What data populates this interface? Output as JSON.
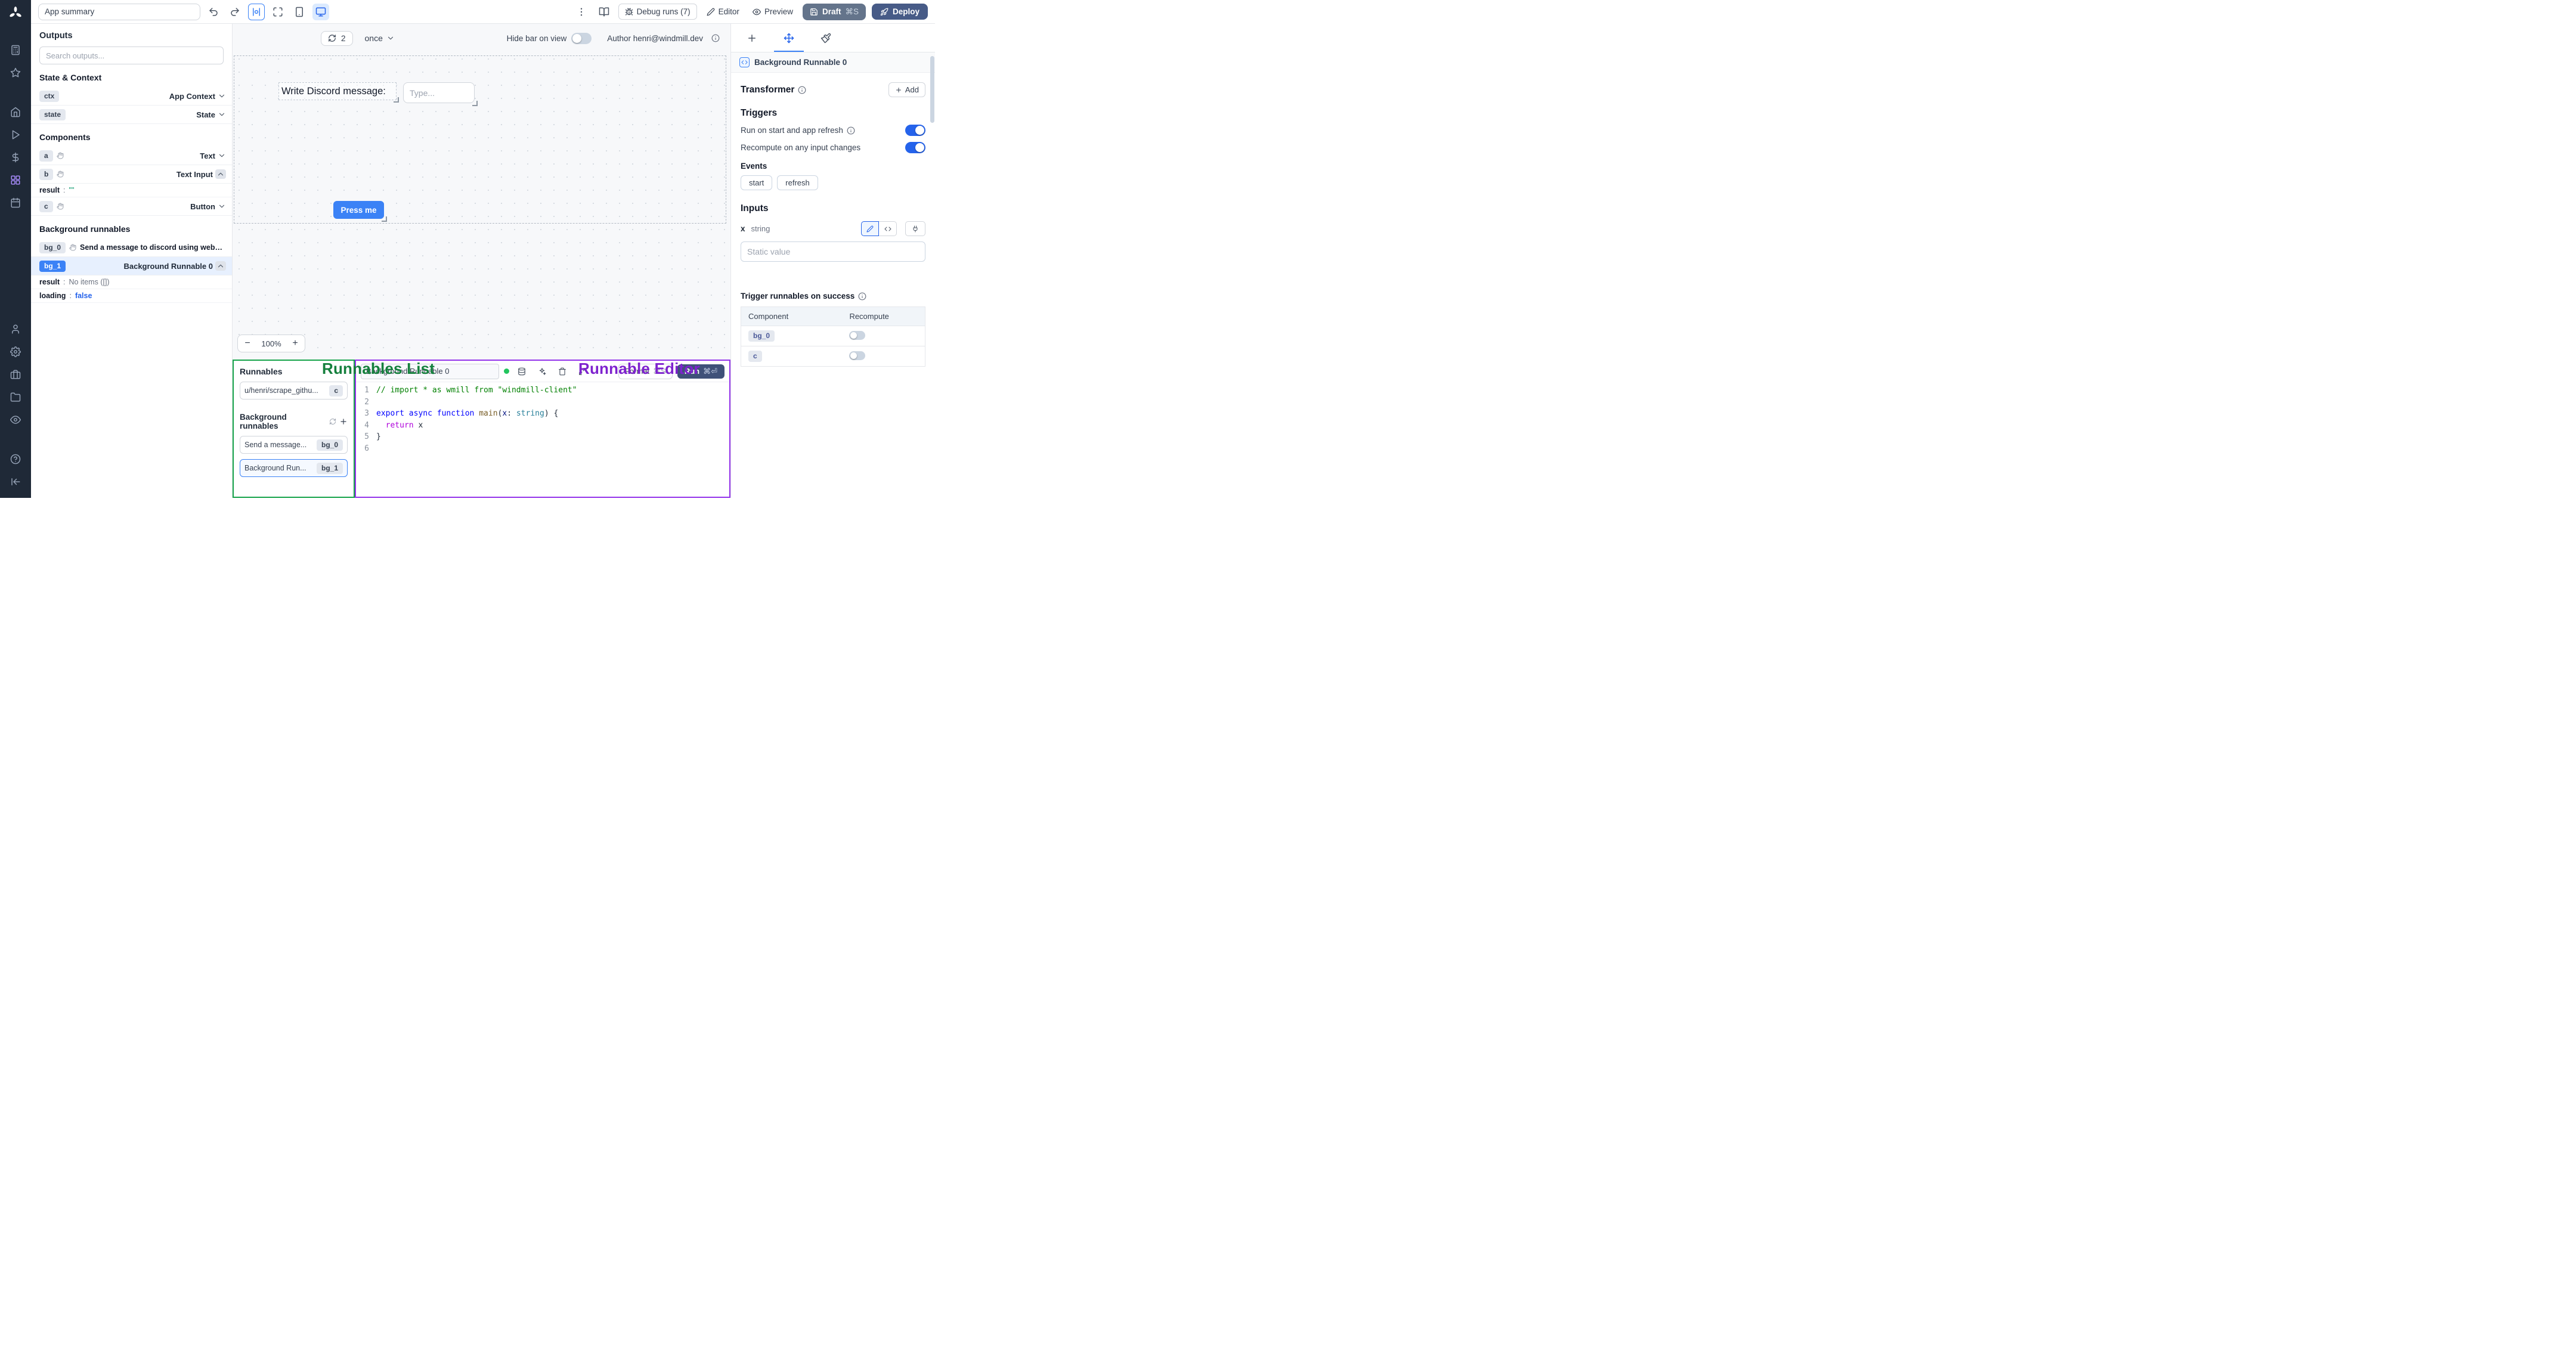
{
  "app": {
    "summary_value": "App summary"
  },
  "topbar": {
    "debug_runs_label": "Debug runs (7)",
    "editor_label": "Editor",
    "preview_label": "Preview",
    "draft_label": "Draft",
    "draft_shortcut": "⌘S",
    "deploy_label": "Deploy"
  },
  "outputs": {
    "title": "Outputs",
    "search_placeholder": "Search outputs...",
    "sections": {
      "state_context_title": "State & Context",
      "components_title": "Components",
      "background_title": "Background runnables"
    },
    "rows": {
      "ctx": {
        "badge": "ctx",
        "label": "App Context"
      },
      "state": {
        "badge": "state",
        "label": "State"
      },
      "a": {
        "badge": "a",
        "label": "Text"
      },
      "b": {
        "badge": "b",
        "label": "Text Input"
      },
      "c": {
        "badge": "c",
        "label": "Button"
      },
      "bg0": {
        "badge": "bg_0",
        "label": "Send a message to discord using webhoo"
      },
      "bg1": {
        "badge": "bg_1",
        "label": "Background Runnable 0"
      }
    },
    "details": {
      "colon": ":",
      "b_result_key": "result",
      "b_result_value": "\"\"",
      "bg1_result_key": "result",
      "bg1_result_value": "No items ([])",
      "bg1_loading_key": "loading",
      "bg1_loading_value": "false"
    }
  },
  "canvas": {
    "refresh_count": "2",
    "interval_value": "once",
    "hide_bar_label": "Hide bar on view",
    "author_label": "Author henri@windmill.dev",
    "zoom_minus": "−",
    "zoom_value": "100%",
    "zoom_plus": "+",
    "components": {
      "text_label": "Write Discord message:",
      "input_placeholder": "Type...",
      "button_label": "Press me"
    }
  },
  "annotations": {
    "runnables_list": "Runnables List",
    "runnable_editor": "Runnable Editor"
  },
  "runnables": {
    "title": "Runnables",
    "script_item": {
      "label": "u/henri/scrape_githu...",
      "badge": "c"
    },
    "background_title": "Background runnables",
    "bg_items": [
      {
        "label": "Send a message...",
        "badge": "bg_0"
      },
      {
        "label": "Background Run...",
        "badge": "bg_1"
      }
    ]
  },
  "editor": {
    "name_value": "Background Runnable 0",
    "format_label": "Format",
    "format_shortcut": "⌘S",
    "run_label": "Run",
    "run_shortcut": "⌘⏎",
    "code_lines": [
      {
        "n": "1",
        "tokens": [
          {
            "c": "comment",
            "t": "// import * as wmill from \"windmill-client\""
          }
        ]
      },
      {
        "n": "2",
        "tokens": []
      },
      {
        "n": "3",
        "tokens": [
          {
            "c": "kw",
            "t": "export"
          },
          {
            "c": "plain",
            "t": " "
          },
          {
            "c": "kw",
            "t": "async"
          },
          {
            "c": "plain",
            "t": " "
          },
          {
            "c": "kw",
            "t": "function"
          },
          {
            "c": "plain",
            "t": " "
          },
          {
            "c": "fn",
            "t": "main"
          },
          {
            "c": "plain",
            "t": "("
          },
          {
            "c": "var",
            "t": "x"
          },
          {
            "c": "plain",
            "t": ": "
          },
          {
            "c": "type",
            "t": "string"
          },
          {
            "c": "plain",
            "t": ") {"
          }
        ]
      },
      {
        "n": "4",
        "tokens": [
          {
            "c": "plain",
            "t": "  "
          },
          {
            "c": "ctrl",
            "t": "return"
          },
          {
            "c": "plain",
            "t": " x"
          }
        ]
      },
      {
        "n": "5",
        "tokens": [
          {
            "c": "plain",
            "t": "}"
          }
        ]
      },
      {
        "n": "6",
        "tokens": []
      }
    ]
  },
  "inspector": {
    "runnable_title": "Background Runnable 0",
    "transformer_title": "Transformer",
    "add_label": "Add",
    "triggers_title": "Triggers",
    "trigger_row1": "Run on start and app refresh",
    "trigger_row2": "Recompute on any input changes",
    "events_title": "Events",
    "event_start": "start",
    "event_refresh": "refresh",
    "inputs_title": "Inputs",
    "input_name": "x",
    "input_type": "string",
    "static_placeholder": "Static value",
    "success_title": "Trigger runnables on success",
    "table": {
      "col_component": "Component",
      "col_recompute": "Recompute",
      "rows": [
        {
          "badge": "bg_0"
        },
        {
          "badge": "c"
        }
      ]
    }
  },
  "colors": {
    "accent_blue": "#3b82f6",
    "toggle_on": "#2563eb",
    "runnables_green": "#16a34a",
    "editor_purple": "#9333ea",
    "annotation_green": "#15803d",
    "annotation_purple": "#7e22ce"
  }
}
